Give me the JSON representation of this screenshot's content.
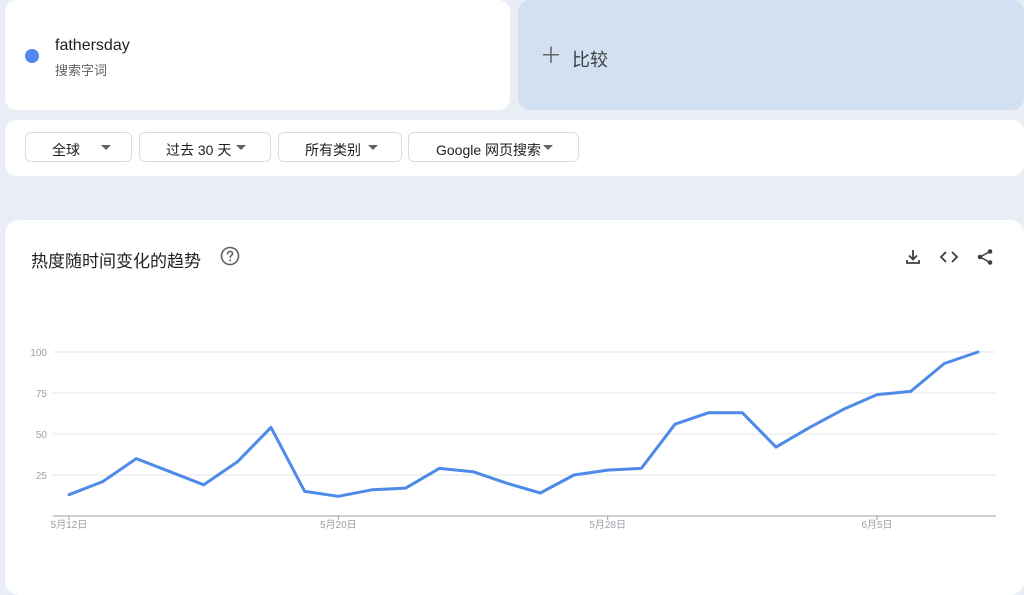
{
  "search_term": {
    "name": "fathersday",
    "type_label": "搜索字词",
    "color": "#4e8ae8"
  },
  "compare": {
    "icon": "plus-icon",
    "label": "比较"
  },
  "filters": [
    {
      "label": "全球"
    },
    {
      "label": "过去 30 天"
    },
    {
      "label": "所有类别"
    },
    {
      "label": "Google 网页搜索"
    }
  ],
  "chart_panel": {
    "title": "热度随时间变化的趋势",
    "help_icon": "help-icon",
    "tools": [
      "download-icon",
      "embed-icon",
      "share-icon"
    ]
  },
  "chart_data": {
    "type": "line",
    "title": "",
    "xlabel": "",
    "ylabel": "",
    "ylim": [
      0,
      100
    ],
    "yticks": [
      25,
      50,
      75,
      100
    ],
    "x_tick_labels": [
      "5月12日",
      "5月20日",
      "5月28日",
      "6月5日"
    ],
    "x_tick_indices": [
      0,
      8,
      16,
      24
    ],
    "grid": true,
    "series": [
      {
        "color": "#4e8ae8",
        "values": [
          13,
          21,
          35,
          27,
          19,
          33,
          54,
          15,
          12,
          16,
          17,
          29,
          27,
          20,
          14,
          25,
          28,
          29,
          56,
          63,
          63,
          42,
          54,
          65,
          74,
          76,
          93,
          100
        ]
      }
    ]
  }
}
